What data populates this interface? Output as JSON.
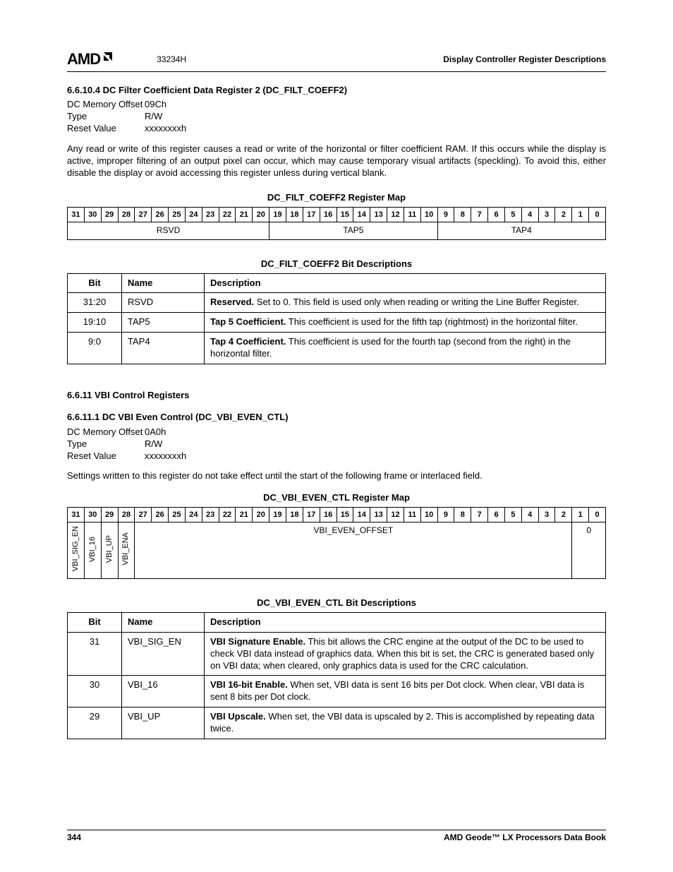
{
  "header": {
    "logo_text": "AMD",
    "doc_num": "33234H",
    "right": "Display Controller Register Descriptions"
  },
  "s1": {
    "heading": "6.6.10.4   DC Filter Coefficient Data Register 2 (DC_FILT_COEFF2)",
    "offset_l": "DC Memory Offset",
    "offset_v": "09Ch",
    "type_l": "Type",
    "type_v": "R/W",
    "reset_l": "Reset Value",
    "reset_v": "xxxxxxxxh",
    "para": "Any read or write of this register causes a read or write of the horizontal or filter coefficient RAM. If this occurs while the display is active, improper filtering of an output pixel can occur, which may cause temporary visual artifacts (speckling). To avoid this, either disable the display or avoid accessing this register unless during vertical blank.",
    "map_title": "DC_FILT_COEFF2 Register Map",
    "map_fields": {
      "f0": "RSVD",
      "f1": "TAP5",
      "f2": "TAP4"
    },
    "bits_title": "DC_FILT_COEFF2 Bit Descriptions",
    "table_h": {
      "bit": "Bit",
      "name": "Name",
      "desc": "Description"
    },
    "rows": [
      {
        "bit": "31:20",
        "name": "RSVD",
        "b": "Reserved.",
        "t": " Set to 0. This field is used only when reading or writing the Line Buffer Register."
      },
      {
        "bit": "19:10",
        "name": "TAP5",
        "b": "Tap 5 Coefficient.",
        "t": " This coefficient is used for the fifth tap (rightmost) in the horizontal filter."
      },
      {
        "bit": "9:0",
        "name": "TAP4",
        "b": "Tap 4 Coefficient.",
        "t": " This coefficient is used for the fourth tap (second from the right) in the horizontal filter."
      }
    ]
  },
  "s2": {
    "heading_group": "6.6.11     VBI Control Registers",
    "heading": "6.6.11.1   DC VBI Even Control (DC_VBI_EVEN_CTL)",
    "offset_l": "DC Memory Offset",
    "offset_v": "0A0h",
    "type_l": "Type",
    "type_v": "R/W",
    "reset_l": "Reset Value",
    "reset_v": "xxxxxxxxh",
    "para": "Settings written to this register do not take effect until the start of the following frame or interlaced field.",
    "map_title": "DC_VBI_EVEN_CTL Register Map",
    "map_fields": {
      "b31": "VBI_SIG_EN",
      "b30": "VBI_16",
      "b29": "VBI_UP",
      "b28": "VBI_ENA",
      "mid": "VBI_EVEN_OFFSET",
      "last": "0"
    },
    "bits_title": "DC_VBI_EVEN_CTL Bit Descriptions",
    "table_h": {
      "bit": "Bit",
      "name": "Name",
      "desc": "Description"
    },
    "rows": [
      {
        "bit": "31",
        "name": "VBI_SIG_EN",
        "b": "VBI Signature Enable.",
        "t": " This bit allows the CRC engine at the output of the DC to be used to check VBI data instead of graphics data. When this bit is set, the CRC is generated based only on VBI data; when cleared, only graphics data is used for the CRC calculation."
      },
      {
        "bit": "30",
        "name": "VBI_16",
        "b": "VBI 16-bit Enable.",
        "t": " When set, VBI data is sent 16 bits per Dot clock. When clear, VBI data is sent 8 bits per Dot clock."
      },
      {
        "bit": "29",
        "name": "VBI_UP",
        "b": "VBI Upscale.",
        "t": " When set, the VBI data is upscaled by 2. This is accomplished by repeating data twice."
      }
    ]
  },
  "bit_numbers": [
    "31",
    "30",
    "29",
    "28",
    "27",
    "26",
    "25",
    "24",
    "23",
    "22",
    "21",
    "20",
    "19",
    "18",
    "17",
    "16",
    "15",
    "14",
    "13",
    "12",
    "11",
    "10",
    "9",
    "8",
    "7",
    "6",
    "5",
    "4",
    "3",
    "2",
    "1",
    "0"
  ],
  "footer": {
    "page": "344",
    "book": "AMD Geode™ LX Processors Data Book"
  }
}
